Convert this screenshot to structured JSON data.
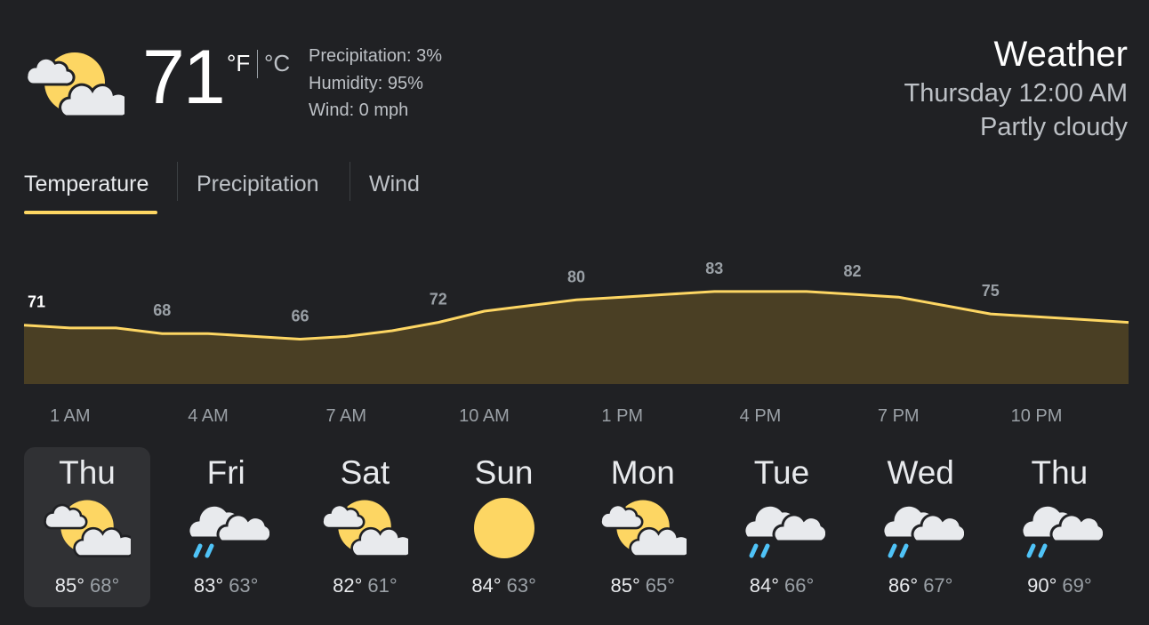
{
  "current": {
    "temp": "71",
    "unit_f": "°F",
    "unit_c": "°C",
    "icon": "partly-cloudy-icon",
    "precipitation": "Precipitation: 3%",
    "humidity": "Humidity: 95%",
    "wind": "Wind: 0 mph"
  },
  "header": {
    "title": "Weather",
    "datetime": "Thursday 12:00 AM",
    "condition": "Partly cloudy"
  },
  "tabs": [
    {
      "label": "Temperature",
      "selected": true
    },
    {
      "label": "Precipitation",
      "selected": false
    },
    {
      "label": "Wind",
      "selected": false
    }
  ],
  "colors": {
    "background": "#202124",
    "accent": "#fdd663",
    "chart_fill": "#4a3f24",
    "selected_day": "#303134",
    "rain": "#4fc3f7"
  },
  "chart_data": {
    "type": "area",
    "x": [
      "12 AM",
      "1 AM",
      "2 AM",
      "3 AM",
      "4 AM",
      "5 AM",
      "6 AM",
      "7 AM",
      "8 AM",
      "9 AM",
      "10 AM",
      "11 AM",
      "12 PM",
      "1 PM",
      "2 PM",
      "3 PM",
      "4 PM",
      "5 PM",
      "6 PM",
      "7 PM",
      "8 PM",
      "9 PM",
      "10 PM",
      "11 PM",
      "12 AM"
    ],
    "y": [
      71,
      70,
      70,
      68,
      68,
      67,
      66,
      67,
      69,
      72,
      76,
      78,
      80,
      81,
      82,
      83,
      83,
      83,
      82,
      81,
      78,
      75,
      74,
      73,
      72
    ],
    "point_labels": [
      {
        "index": 0,
        "text": "71"
      },
      {
        "index": 3,
        "text": "68"
      },
      {
        "index": 6,
        "text": "66"
      },
      {
        "index": 9,
        "text": "72"
      },
      {
        "index": 12,
        "text": "80"
      },
      {
        "index": 15,
        "text": "83"
      },
      {
        "index": 18,
        "text": "82"
      },
      {
        "index": 21,
        "text": "75"
      }
    ],
    "hour_ticks": [
      {
        "index": 1,
        "text": "1 AM"
      },
      {
        "index": 4,
        "text": "4 AM"
      },
      {
        "index": 7,
        "text": "7 AM"
      },
      {
        "index": 10,
        "text": "10 AM"
      },
      {
        "index": 13,
        "text": "1 PM"
      },
      {
        "index": 16,
        "text": "4 PM"
      },
      {
        "index": 19,
        "text": "7 PM"
      },
      {
        "index": 22,
        "text": "10 PM"
      }
    ],
    "ylim": [
      50,
      95
    ],
    "grid": false,
    "legend": "none"
  },
  "forecast": [
    {
      "day": "Thu",
      "icon": "partly-cloudy-icon",
      "high": "85°",
      "low": "68°",
      "selected": true
    },
    {
      "day": "Fri",
      "icon": "rain-cloud-icon",
      "high": "83°",
      "low": "63°",
      "selected": false
    },
    {
      "day": "Sat",
      "icon": "partly-cloudy-icon",
      "high": "82°",
      "low": "61°",
      "selected": false
    },
    {
      "day": "Sun",
      "icon": "sun-icon",
      "high": "84°",
      "low": "63°",
      "selected": false
    },
    {
      "day": "Mon",
      "icon": "partly-cloudy-icon",
      "high": "85°",
      "low": "65°",
      "selected": false
    },
    {
      "day": "Tue",
      "icon": "rain-cloud-icon",
      "high": "84°",
      "low": "66°",
      "selected": false
    },
    {
      "day": "Wed",
      "icon": "rain-cloud-icon",
      "high": "86°",
      "low": "67°",
      "selected": false
    },
    {
      "day": "Thu",
      "icon": "rain-cloud-icon",
      "high": "90°",
      "low": "69°",
      "selected": false
    }
  ]
}
